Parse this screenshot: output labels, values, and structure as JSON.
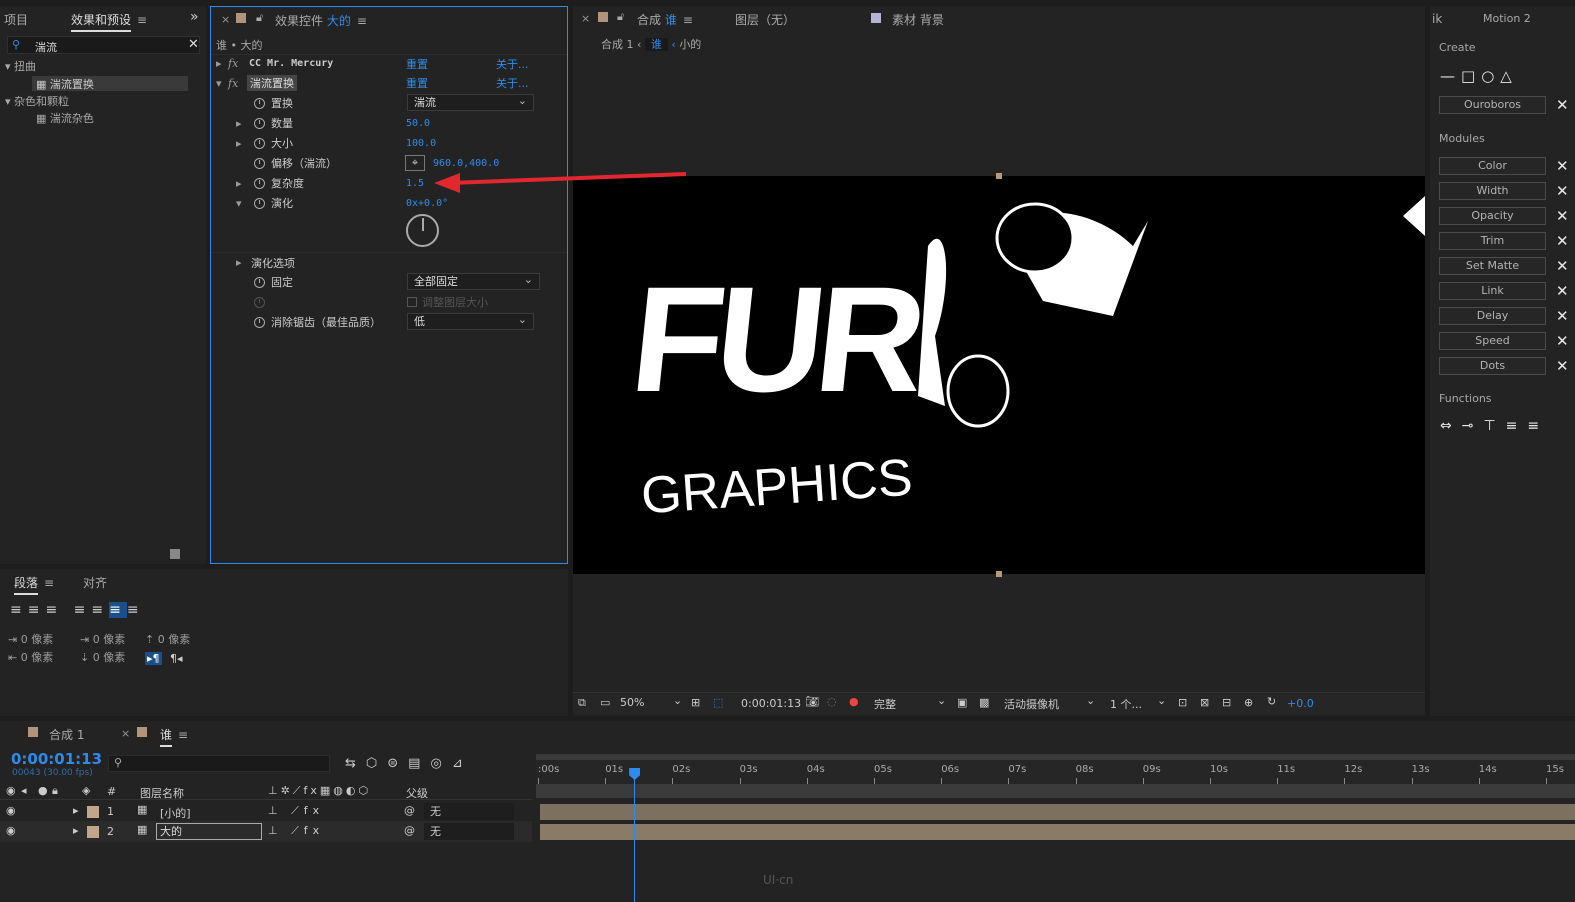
{
  "project_panel": {
    "tab_project": "项目",
    "tab_effects": "效果和预设",
    "search_value": "湍流",
    "groups": [
      {
        "name": "扭曲",
        "item": "湍流置换"
      },
      {
        "name": "杂色和颗粒",
        "item": "湍流杂色"
      }
    ]
  },
  "effect_controls": {
    "title_prefix": "效果控件",
    "layer": "大的",
    "breadcrumb": "谁 • 大的",
    "effects": [
      {
        "name": "CC Mr. Mercury",
        "reset": "重置",
        "about": "关于..."
      },
      {
        "name": "湍流置换",
        "reset": "重置",
        "about": "关于..."
      }
    ],
    "props": {
      "displace_label": "置换",
      "displace_value": "湍流",
      "amount_label": "数量",
      "amount_value": "50.0",
      "size_label": "大小",
      "size_value": "100.0",
      "offset_label": "偏移（湍流）",
      "offset_value": "960.0,400.0",
      "complexity_label": "复杂度",
      "complexity_value": "1.5",
      "evolution_label": "演化",
      "evolution_value": "0x+0.0°",
      "evo_options_label": "演化选项",
      "pin_label": "固定",
      "pin_value": "全部固定",
      "resize_label": "调整图层大小",
      "aa_label": "消除锯齿（最佳品质）",
      "aa_value": "低"
    }
  },
  "paragraph_panel": {
    "tab_paragraph": "段落",
    "tab_align": "对齐",
    "indent1": "0 像素",
    "indent2": "0 像素",
    "indent3": "0 像素",
    "indent4": "0 像素",
    "indent5": "0 像素"
  },
  "comp_panel": {
    "title_prefix": "合成",
    "comp_name": "谁",
    "layer_tab": "图层（无）",
    "footage_tab": "素材 背景",
    "crumb1": "合成 1",
    "crumb2": "谁",
    "crumb3": "小的",
    "preview_text_top": "FUR",
    "preview_text_bottom": "GRAPHICS",
    "zoom": "50%",
    "timecode": "0:00:01:13",
    "quality": "完整",
    "camera": "活动摄像机",
    "views": "1 个...",
    "exposure": "+0.0"
  },
  "motion_panel": {
    "tab_left": "ik",
    "title": "Motion 2",
    "create_label": "Create",
    "ouroboros": "Ouroboros",
    "modules_label": "Modules",
    "modules": [
      "Color",
      "Width",
      "Opacity",
      "Trim",
      "Set Matte",
      "Link",
      "Delay",
      "Speed",
      "Dots"
    ],
    "functions_label": "Functions"
  },
  "timeline": {
    "tab_comp1": "合成 1",
    "tab_who": "谁",
    "timecode": "0:00:01:13",
    "frames": "00043 (30.00 fps)",
    "col_num": "#",
    "col_layer_name": "图层名称",
    "col_parent": "父级",
    "layers": [
      {
        "num": "1",
        "name": "[小的]",
        "parent": "无"
      },
      {
        "num": "2",
        "name": "大的",
        "parent": "无"
      }
    ],
    "ruler": [
      ":00s",
      "01s",
      "02s",
      "03s",
      "04s",
      "05s",
      "06s",
      "07s",
      "08s",
      "09s",
      "10s",
      "11s",
      "12s",
      "13s",
      "14s",
      "15s"
    ],
    "playhead_seconds": 1.43
  },
  "watermark": "UI·cn",
  "colors": {
    "accent": "#2d8ceb",
    "annotation_arrow": "#e0282e",
    "layer_bar": "#7d705f"
  }
}
